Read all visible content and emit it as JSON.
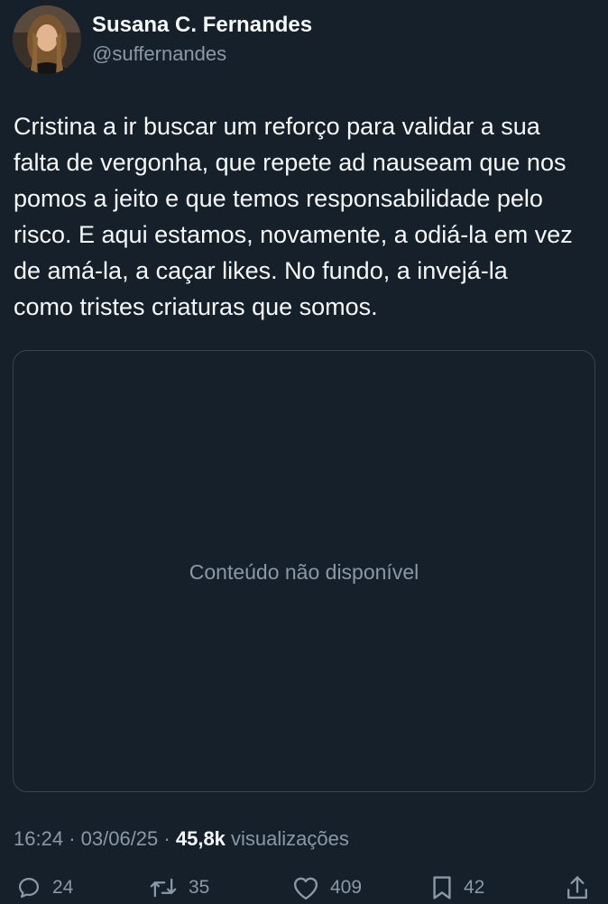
{
  "author": {
    "display_name": "Susana C. Fernandes",
    "handle": "@suffernandes"
  },
  "tweet": {
    "text": "Cristina a ir buscar um reforço para validar a sua\nfalta de vergonha, que repete ad nauseam que nos\npomos a jeito e que temos responsabilidade pelo\nrisco. E aqui estamos, novamente, a odiá-la em vez\nde amá-la, a caçar likes. No fundo, a invejá-la\ncomo tristes criaturas que somos."
  },
  "media": {
    "unavailable_text": "Conteúdo não disponível"
  },
  "meta": {
    "time": "16:24",
    "separator": "·",
    "date": "03/06/25",
    "views_count": "45,8k",
    "views_label": "visualizações"
  },
  "actions": {
    "reply": {
      "icon": "reply-icon",
      "count": "24"
    },
    "retweet": {
      "icon": "retweet-icon",
      "count": "35"
    },
    "like": {
      "icon": "heart-icon",
      "count": "409"
    },
    "bookmark": {
      "icon": "bookmark-icon",
      "count": "42"
    },
    "share": {
      "icon": "share-icon"
    }
  },
  "colors": {
    "background": "#15202b",
    "text_primary": "#f7f9f9",
    "text_secondary": "#8b98a5",
    "border": "#38444d"
  }
}
